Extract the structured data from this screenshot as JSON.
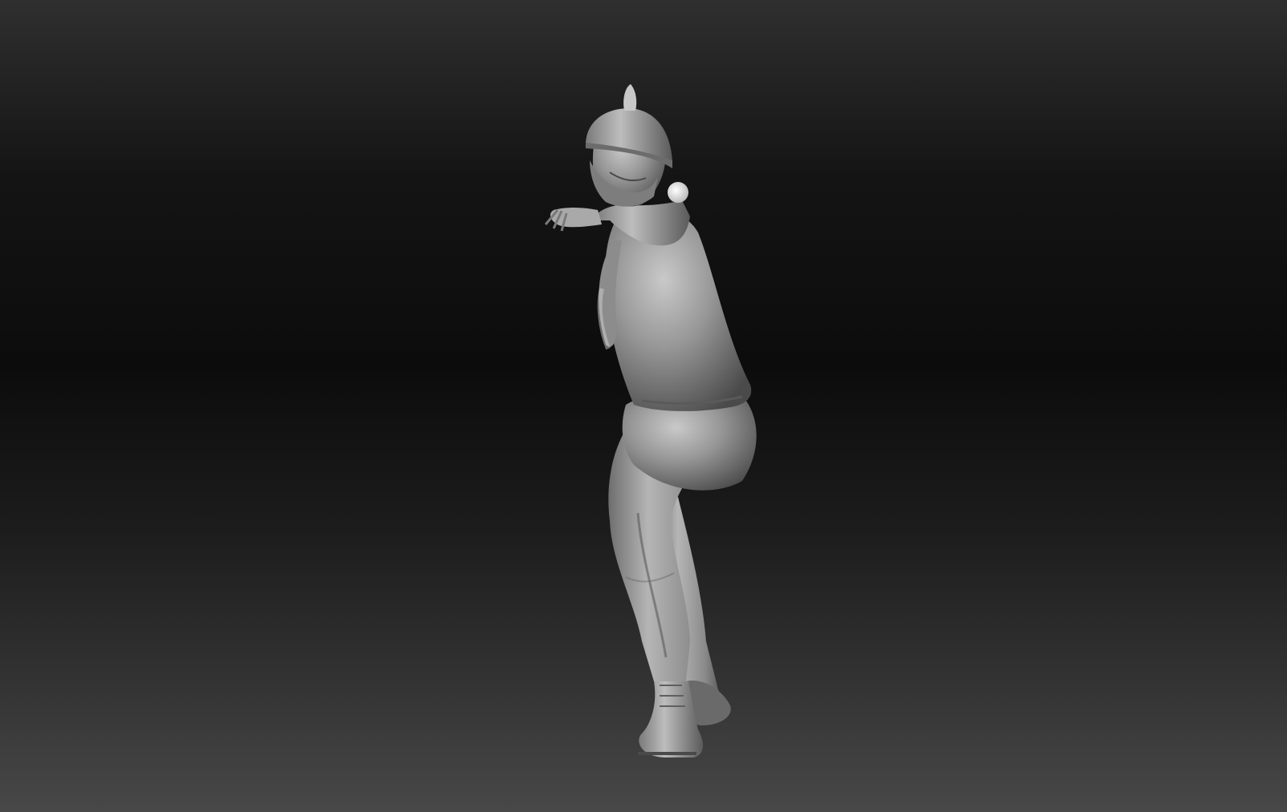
{
  "app": {
    "title": ""
  },
  "viewport": {
    "background_top": "#2f2f2f",
    "background_mid": "#0c0c0c",
    "background_bottom": "#484848",
    "model_color": "#8e8e8e",
    "model_highlight": "#cfcfcf",
    "model_shadow": "#3e3e3e"
  },
  "scene": {
    "subject": "sculpted-figure",
    "pivot_marker": "pivot-sphere-icon"
  }
}
